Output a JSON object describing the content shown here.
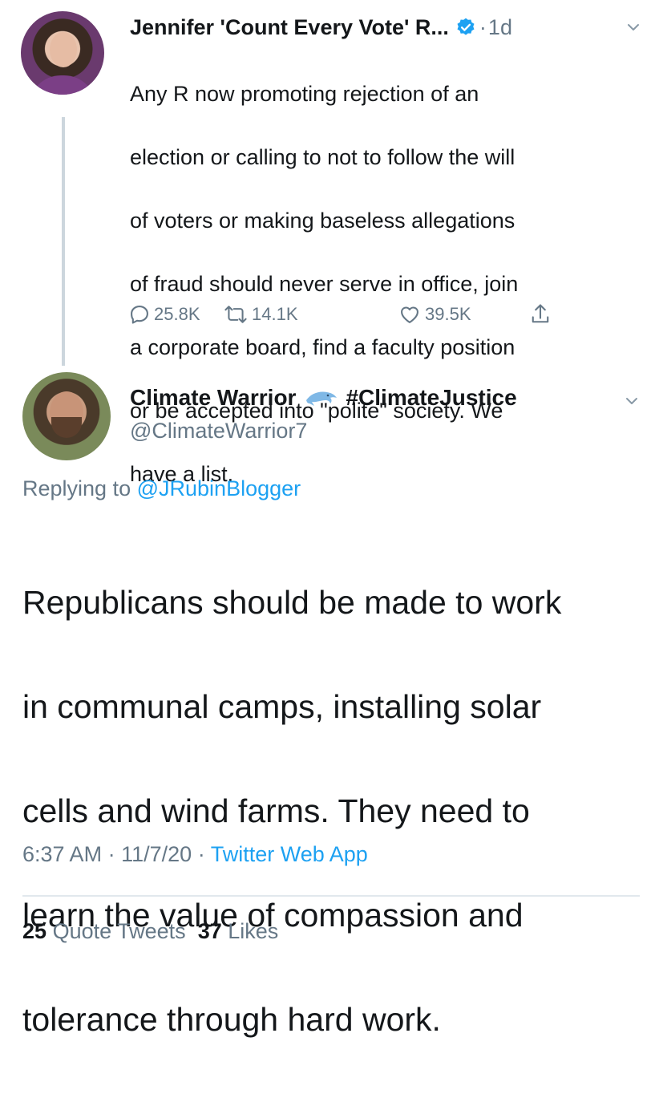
{
  "parent_tweet": {
    "display_name": "Jennifer 'Count Every Vote' R...",
    "time_sep": "·",
    "time": "1d",
    "text_lines": [
      "Any R now promoting rejection of an",
      "election or calling to not to follow the will",
      "of voters or making baseless allegations",
      "of fraud should never serve in office, join",
      "a corporate board, find a faculty position",
      "or be accepted into \"polite\" society. We",
      "have a list."
    ],
    "replies": "25.8K",
    "retweets": "14.1K",
    "likes": "39.5K"
  },
  "reply_tweet": {
    "display_name": "Climate Warrior",
    "display_name_suffix": "#ClimateJustice",
    "handle": "@ClimateWarrior7",
    "replying_prefix": "Replying to",
    "replying_to": "@JRubinBlogger",
    "text_lines": [
      "Republicans should be made to work",
      "in communal camps, installing solar",
      "cells and wind farms. They need to",
      "learn the value of compassion and",
      "tolerance through hard work."
    ],
    "time": "6:37 AM",
    "date": "11/7/20",
    "meta_sep": "·",
    "source": "Twitter Web App",
    "quote_tweets_count": "25",
    "quote_tweets_label": "Quote Tweets",
    "likes_count": "37",
    "likes_label": "Likes"
  },
  "colors": {
    "text": "#14171a",
    "secondary": "#657786",
    "link": "#1da1f2",
    "divider": "#e1e8ed"
  },
  "icons": [
    "verified-badge-icon",
    "chevron-down-icon",
    "reply-icon",
    "retweet-icon",
    "like-icon",
    "share-icon",
    "dolphin-emoji-icon"
  ]
}
